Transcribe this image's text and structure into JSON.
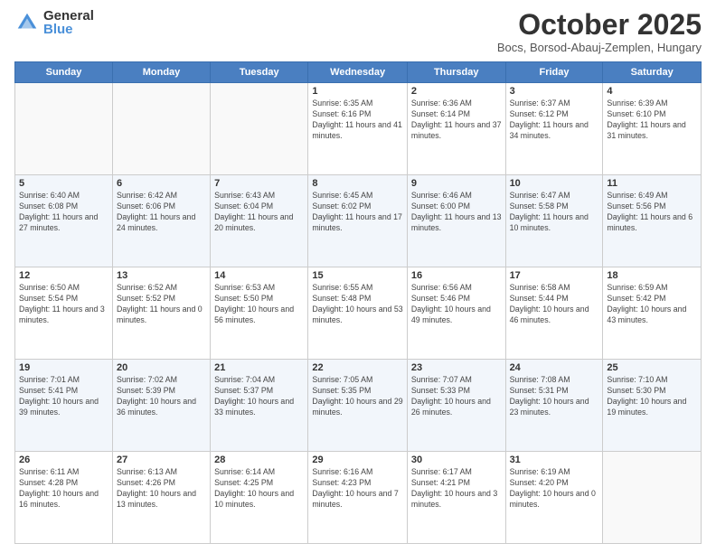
{
  "header": {
    "logo_general": "General",
    "logo_blue": "Blue",
    "title": "October 2025",
    "subtitle": "Bocs, Borsod-Abauj-Zemplen, Hungary"
  },
  "days_of_week": [
    "Sunday",
    "Monday",
    "Tuesday",
    "Wednesday",
    "Thursday",
    "Friday",
    "Saturday"
  ],
  "weeks": [
    [
      {
        "day": "",
        "info": ""
      },
      {
        "day": "",
        "info": ""
      },
      {
        "day": "",
        "info": ""
      },
      {
        "day": "1",
        "info": "Sunrise: 6:35 AM\nSunset: 6:16 PM\nDaylight: 11 hours and 41 minutes."
      },
      {
        "day": "2",
        "info": "Sunrise: 6:36 AM\nSunset: 6:14 PM\nDaylight: 11 hours and 37 minutes."
      },
      {
        "day": "3",
        "info": "Sunrise: 6:37 AM\nSunset: 6:12 PM\nDaylight: 11 hours and 34 minutes."
      },
      {
        "day": "4",
        "info": "Sunrise: 6:39 AM\nSunset: 6:10 PM\nDaylight: 11 hours and 31 minutes."
      }
    ],
    [
      {
        "day": "5",
        "info": "Sunrise: 6:40 AM\nSunset: 6:08 PM\nDaylight: 11 hours and 27 minutes."
      },
      {
        "day": "6",
        "info": "Sunrise: 6:42 AM\nSunset: 6:06 PM\nDaylight: 11 hours and 24 minutes."
      },
      {
        "day": "7",
        "info": "Sunrise: 6:43 AM\nSunset: 6:04 PM\nDaylight: 11 hours and 20 minutes."
      },
      {
        "day": "8",
        "info": "Sunrise: 6:45 AM\nSunset: 6:02 PM\nDaylight: 11 hours and 17 minutes."
      },
      {
        "day": "9",
        "info": "Sunrise: 6:46 AM\nSunset: 6:00 PM\nDaylight: 11 hours and 13 minutes."
      },
      {
        "day": "10",
        "info": "Sunrise: 6:47 AM\nSunset: 5:58 PM\nDaylight: 11 hours and 10 minutes."
      },
      {
        "day": "11",
        "info": "Sunrise: 6:49 AM\nSunset: 5:56 PM\nDaylight: 11 hours and 6 minutes."
      }
    ],
    [
      {
        "day": "12",
        "info": "Sunrise: 6:50 AM\nSunset: 5:54 PM\nDaylight: 11 hours and 3 minutes."
      },
      {
        "day": "13",
        "info": "Sunrise: 6:52 AM\nSunset: 5:52 PM\nDaylight: 11 hours and 0 minutes."
      },
      {
        "day": "14",
        "info": "Sunrise: 6:53 AM\nSunset: 5:50 PM\nDaylight: 10 hours and 56 minutes."
      },
      {
        "day": "15",
        "info": "Sunrise: 6:55 AM\nSunset: 5:48 PM\nDaylight: 10 hours and 53 minutes."
      },
      {
        "day": "16",
        "info": "Sunrise: 6:56 AM\nSunset: 5:46 PM\nDaylight: 10 hours and 49 minutes."
      },
      {
        "day": "17",
        "info": "Sunrise: 6:58 AM\nSunset: 5:44 PM\nDaylight: 10 hours and 46 minutes."
      },
      {
        "day": "18",
        "info": "Sunrise: 6:59 AM\nSunset: 5:42 PM\nDaylight: 10 hours and 43 minutes."
      }
    ],
    [
      {
        "day": "19",
        "info": "Sunrise: 7:01 AM\nSunset: 5:41 PM\nDaylight: 10 hours and 39 minutes."
      },
      {
        "day": "20",
        "info": "Sunrise: 7:02 AM\nSunset: 5:39 PM\nDaylight: 10 hours and 36 minutes."
      },
      {
        "day": "21",
        "info": "Sunrise: 7:04 AM\nSunset: 5:37 PM\nDaylight: 10 hours and 33 minutes."
      },
      {
        "day": "22",
        "info": "Sunrise: 7:05 AM\nSunset: 5:35 PM\nDaylight: 10 hours and 29 minutes."
      },
      {
        "day": "23",
        "info": "Sunrise: 7:07 AM\nSunset: 5:33 PM\nDaylight: 10 hours and 26 minutes."
      },
      {
        "day": "24",
        "info": "Sunrise: 7:08 AM\nSunset: 5:31 PM\nDaylight: 10 hours and 23 minutes."
      },
      {
        "day": "25",
        "info": "Sunrise: 7:10 AM\nSunset: 5:30 PM\nDaylight: 10 hours and 19 minutes."
      }
    ],
    [
      {
        "day": "26",
        "info": "Sunrise: 6:11 AM\nSunset: 4:28 PM\nDaylight: 10 hours and 16 minutes."
      },
      {
        "day": "27",
        "info": "Sunrise: 6:13 AM\nSunset: 4:26 PM\nDaylight: 10 hours and 13 minutes."
      },
      {
        "day": "28",
        "info": "Sunrise: 6:14 AM\nSunset: 4:25 PM\nDaylight: 10 hours and 10 minutes."
      },
      {
        "day": "29",
        "info": "Sunrise: 6:16 AM\nSunset: 4:23 PM\nDaylight: 10 hours and 7 minutes."
      },
      {
        "day": "30",
        "info": "Sunrise: 6:17 AM\nSunset: 4:21 PM\nDaylight: 10 hours and 3 minutes."
      },
      {
        "day": "31",
        "info": "Sunrise: 6:19 AM\nSunset: 4:20 PM\nDaylight: 10 hours and 0 minutes."
      },
      {
        "day": "",
        "info": ""
      }
    ]
  ]
}
